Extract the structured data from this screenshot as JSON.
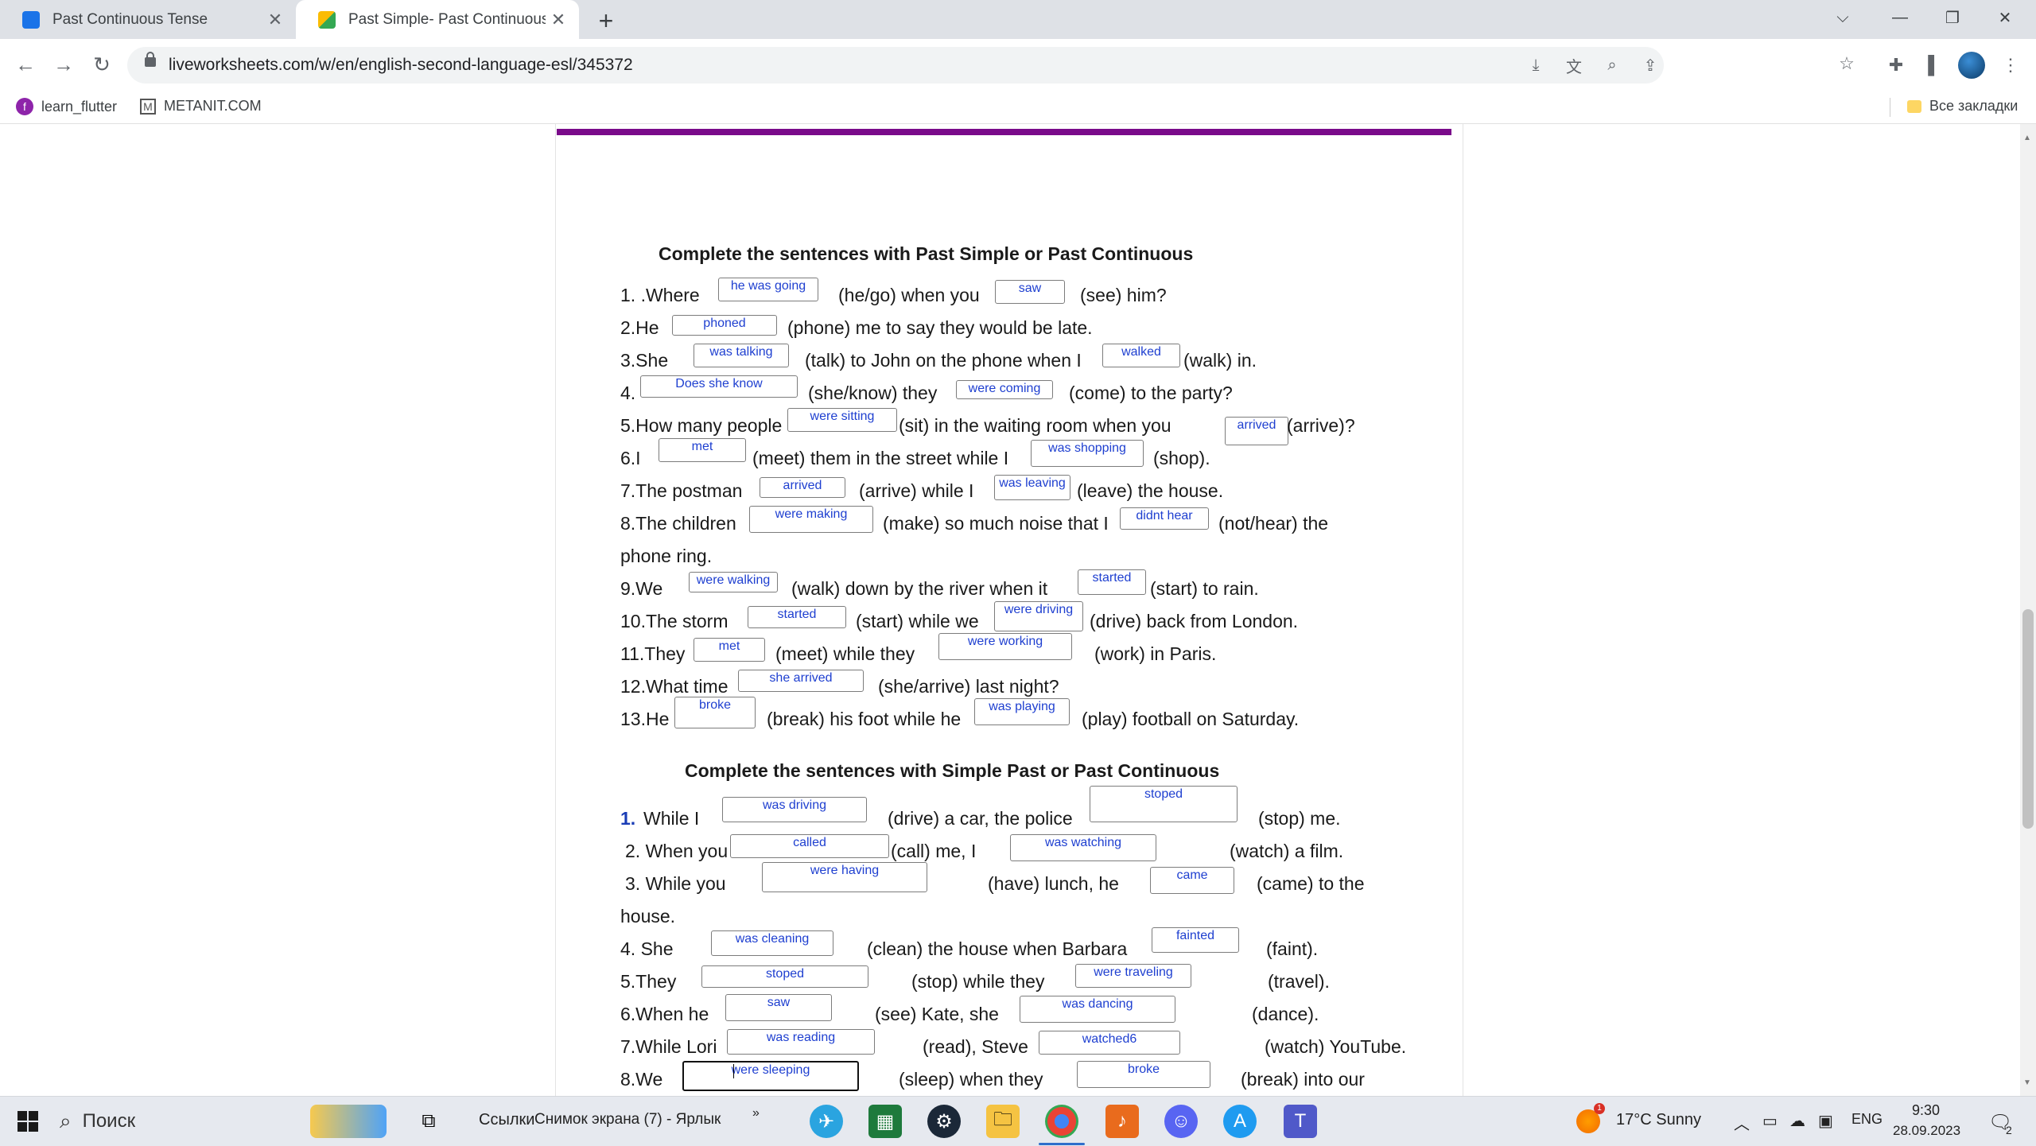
{
  "browser": {
    "tabs": [
      {
        "title": "Past Continuous Tense",
        "active": false,
        "favicon_color": "#1a73e8"
      },
      {
        "title": "Past Simple- Past Continuous ac",
        "active": true,
        "favicon_color": "#34a853"
      }
    ],
    "url": "liveworksheets.com/w/en/english-second-language-esl/345372",
    "bookmarks": [
      "learn_flutter",
      "METANIT.COM"
    ],
    "all_bookmarks": "Все закладки"
  },
  "worksheet": {
    "section1": {
      "title": "Complete the sentences with Past Simple or Past Continuous",
      "lines": [
        {
          "texts": [
            "1. .Where",
            "(he/go) when you",
            "(see) him?"
          ],
          "answers": [
            "he was going",
            "saw"
          ]
        },
        {
          "texts": [
            "2.He",
            "(phone) me to say they would be late."
          ],
          "answers": [
            "phoned"
          ]
        },
        {
          "texts": [
            "3.She",
            "(talk) to John on the phone when I",
            "(walk) in."
          ],
          "answers": [
            "was talking",
            "walked"
          ]
        },
        {
          "texts": [
            "4.",
            "(she/know) they",
            "(come) to the party?"
          ],
          "answers": [
            "Does she know",
            "were coming"
          ]
        },
        {
          "texts": [
            "5.How many people",
            "(sit) in the waiting room when you",
            "(arrive)?"
          ],
          "answers": [
            "were sitting",
            "arrived"
          ]
        },
        {
          "texts": [
            "6.I",
            "(meet) them in the street while I",
            "(shop)."
          ],
          "answers": [
            "met",
            "was shopping"
          ]
        },
        {
          "texts": [
            "7.The postman",
            "(arrive) while I",
            "(leave) the house."
          ],
          "answers": [
            "arrived",
            "was leaving"
          ]
        },
        {
          "texts": [
            "8.The children",
            "(make) so much noise that I",
            "(not/hear) the"
          ],
          "answers": [
            "were making",
            "didnt hear"
          ]
        },
        {
          "texts": [
            "phone ring."
          ],
          "answers": []
        },
        {
          "texts": [
            "9.We",
            "(walk) down by the river when it",
            "(start) to rain."
          ],
          "answers": [
            "were walking",
            "started"
          ]
        },
        {
          "texts": [
            "10.The storm",
            "(start) while we",
            "(drive) back from London."
          ],
          "answers": [
            "started",
            "were driving"
          ]
        },
        {
          "texts": [
            "11.They",
            "(meet) while they",
            "(work) in Paris."
          ],
          "answers": [
            "met",
            "were working"
          ]
        },
        {
          "texts": [
            "12.What time",
            "(she/arrive) last night?"
          ],
          "answers": [
            "she arrived"
          ]
        },
        {
          "texts": [
            "13.He",
            "(break) his foot while he",
            "(play) football on Saturday."
          ],
          "answers": [
            "broke",
            "was playing"
          ]
        }
      ]
    },
    "section2": {
      "title": "Complete the sentences with Simple Past or Past Continuous",
      "lines": [
        {
          "num": "1.",
          "texts": [
            "While I",
            "(drive) a car, the police",
            "(stop) me."
          ],
          "answers": [
            "was driving",
            "stoped"
          ]
        },
        {
          "texts": [
            "2. When you",
            "(call) me, I",
            "(watch) a film."
          ],
          "answers": [
            "called",
            "was watching"
          ]
        },
        {
          "texts": [
            "3. While you",
            "(have) lunch, he",
            "(came) to the"
          ],
          "answers": [
            "were having",
            "came"
          ]
        },
        {
          "texts": [
            "house."
          ],
          "answers": []
        },
        {
          "texts": [
            "4. She",
            "(clean) the house when Barbara",
            "(faint)."
          ],
          "answers": [
            "was cleaning",
            "fainted"
          ]
        },
        {
          "texts": [
            "5.They",
            "(stop) while they",
            "(travel)."
          ],
          "answers": [
            "stoped",
            "were traveling"
          ]
        },
        {
          "texts": [
            "6.When he",
            "(see) Kate, she",
            "(dance)."
          ],
          "answers": [
            "saw",
            "was dancing"
          ]
        },
        {
          "texts": [
            "7.While Lori",
            "(read), Steve",
            "(watch) YouTube."
          ],
          "answers": [
            "was reading",
            "watched6"
          ]
        },
        {
          "texts": [
            "8.We",
            "(sleep) when they",
            "(break) into our"
          ],
          "answers": [
            "were sleeping",
            "broke"
          ]
        }
      ]
    }
  },
  "taskbar": {
    "search_label": "Поиск",
    "links_label": "Ссылки",
    "shortcut_label": "Снимок экрана (7) - Ярлык",
    "weather": "17°C  Sunny",
    "weather_badge": "1",
    "language": "ENG",
    "time": "9:30",
    "date": "28.09.2023",
    "notifications": "2"
  }
}
